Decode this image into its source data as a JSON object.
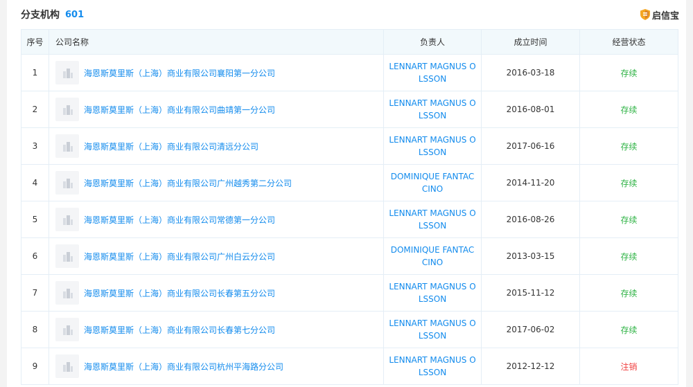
{
  "header": {
    "title": "分支机构",
    "count": "601",
    "brand": "启信宝"
  },
  "table": {
    "columns": [
      "序号",
      "公司名称",
      "负责人",
      "成立时间",
      "经营状态"
    ],
    "rows": [
      {
        "idx": "1",
        "name": "海恩斯莫里斯（上海）商业有限公司襄阳第一分公司",
        "person": "LENNART MAGNUS OLSSON",
        "date": "2016-03-18",
        "status": "存续"
      },
      {
        "idx": "2",
        "name": "海恩斯莫里斯（上海）商业有限公司曲靖第一分公司",
        "person": "LENNART MAGNUS OLSSON",
        "date": "2016-08-01",
        "status": "存续"
      },
      {
        "idx": "3",
        "name": "海恩斯莫里斯（上海）商业有限公司清远分公司",
        "person": "LENNART MAGNUS OLSSON",
        "date": "2017-06-16",
        "status": "存续"
      },
      {
        "idx": "4",
        "name": "海恩斯莫里斯（上海）商业有限公司广州越秀第二分公司",
        "person": "DOMINIQUE FANTACCINO",
        "date": "2014-11-20",
        "status": "存续"
      },
      {
        "idx": "5",
        "name": "海恩斯莫里斯（上海）商业有限公司常德第一分公司",
        "person": "LENNART MAGNUS OLSSON",
        "date": "2016-08-26",
        "status": "存续"
      },
      {
        "idx": "6",
        "name": "海恩斯莫里斯（上海）商业有限公司广州白云分公司",
        "person": "DOMINIQUE FANTACCINO",
        "date": "2013-03-15",
        "status": "存续"
      },
      {
        "idx": "7",
        "name": "海恩斯莫里斯（上海）商业有限公司长春第五分公司",
        "person": "LENNART MAGNUS OLSSON",
        "date": "2015-11-12",
        "status": "存续"
      },
      {
        "idx": "8",
        "name": "海恩斯莫里斯（上海）商业有限公司长春第七分公司",
        "person": "LENNART MAGNUS OLSSON",
        "date": "2017-06-02",
        "status": "存续"
      },
      {
        "idx": "9",
        "name": "海恩斯莫里斯（上海）商业有限公司杭州平海路分公司",
        "person": "LENNART MAGNUS OLSSON",
        "date": "2012-12-12",
        "status": "注销"
      }
    ]
  },
  "colors": {
    "link": "#128bed",
    "status_live": "#2fb345",
    "status_cancel": "#f04040",
    "header_bg": "#f2f9fc"
  },
  "icons": {
    "brand": "shield-icon",
    "company_logo": "company-logo-placeholder"
  }
}
